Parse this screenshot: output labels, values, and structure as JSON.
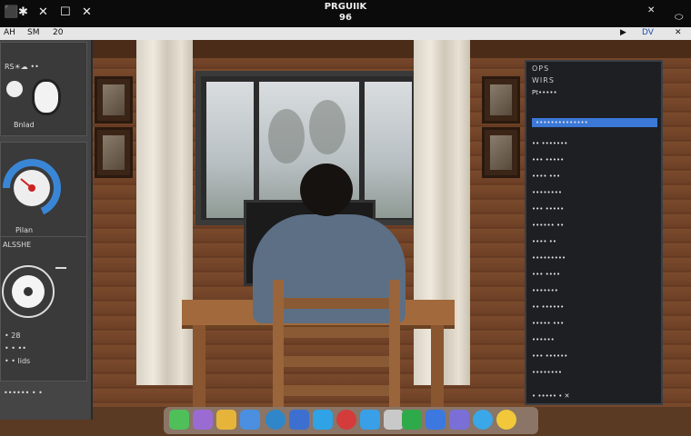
{
  "menubar": {
    "left_items": [
      "⬛",
      "✱",
      "✕",
      "☐",
      "✕"
    ],
    "title_line1": "PRGUIIK",
    "title_line2": "96",
    "close": "✕",
    "right_icon": "⬭"
  },
  "toolbar": {
    "left": [
      "AH",
      "SM",
      "20"
    ],
    "right": [
      "▶",
      "DV",
      "✕"
    ]
  },
  "left_panel": {
    "header": "RS☀☁ ••",
    "section1_label": "Bnlad",
    "section2_label": "Pilan",
    "section3_header": "ALSSHE",
    "readout1": "• 28",
    "readout2": "• • ••",
    "readout3": "• • lids",
    "footer": "•••••• • •"
  },
  "right_panel": {
    "title": "OPS",
    "subtitle": "WIRS",
    "header_text": "Pt•••••",
    "selected_row": "••••••••••••••",
    "rows": [
      "•• •••••••",
      "••• •••••",
      "•••• •••",
      "••••••••",
      "••• •••••",
      "•••••• ••",
      "•••• ••",
      "•••••••••",
      "••• ••••",
      "•••••••",
      "•• ••••••",
      "••••• •••",
      "••••••",
      "••• ••••••",
      "••••••••"
    ],
    "footer": "• ••••• • ✕"
  },
  "colors": {
    "accent": "#3b78d8",
    "gauge": "#3a86d6"
  },
  "dock_apps": [
    "messages-app-icon",
    "photos-app-icon",
    "notes-app-icon",
    "calendar-app-icon",
    "weather-app-icon",
    "files-app-icon",
    "settings-app-icon",
    "record-app-icon",
    "maps-app-icon",
    "cloud-app-icon",
    "terminal-app-icon",
    "store-app-icon",
    "media-app-icon",
    "browser-app-icon",
    "safari-app-icon"
  ]
}
